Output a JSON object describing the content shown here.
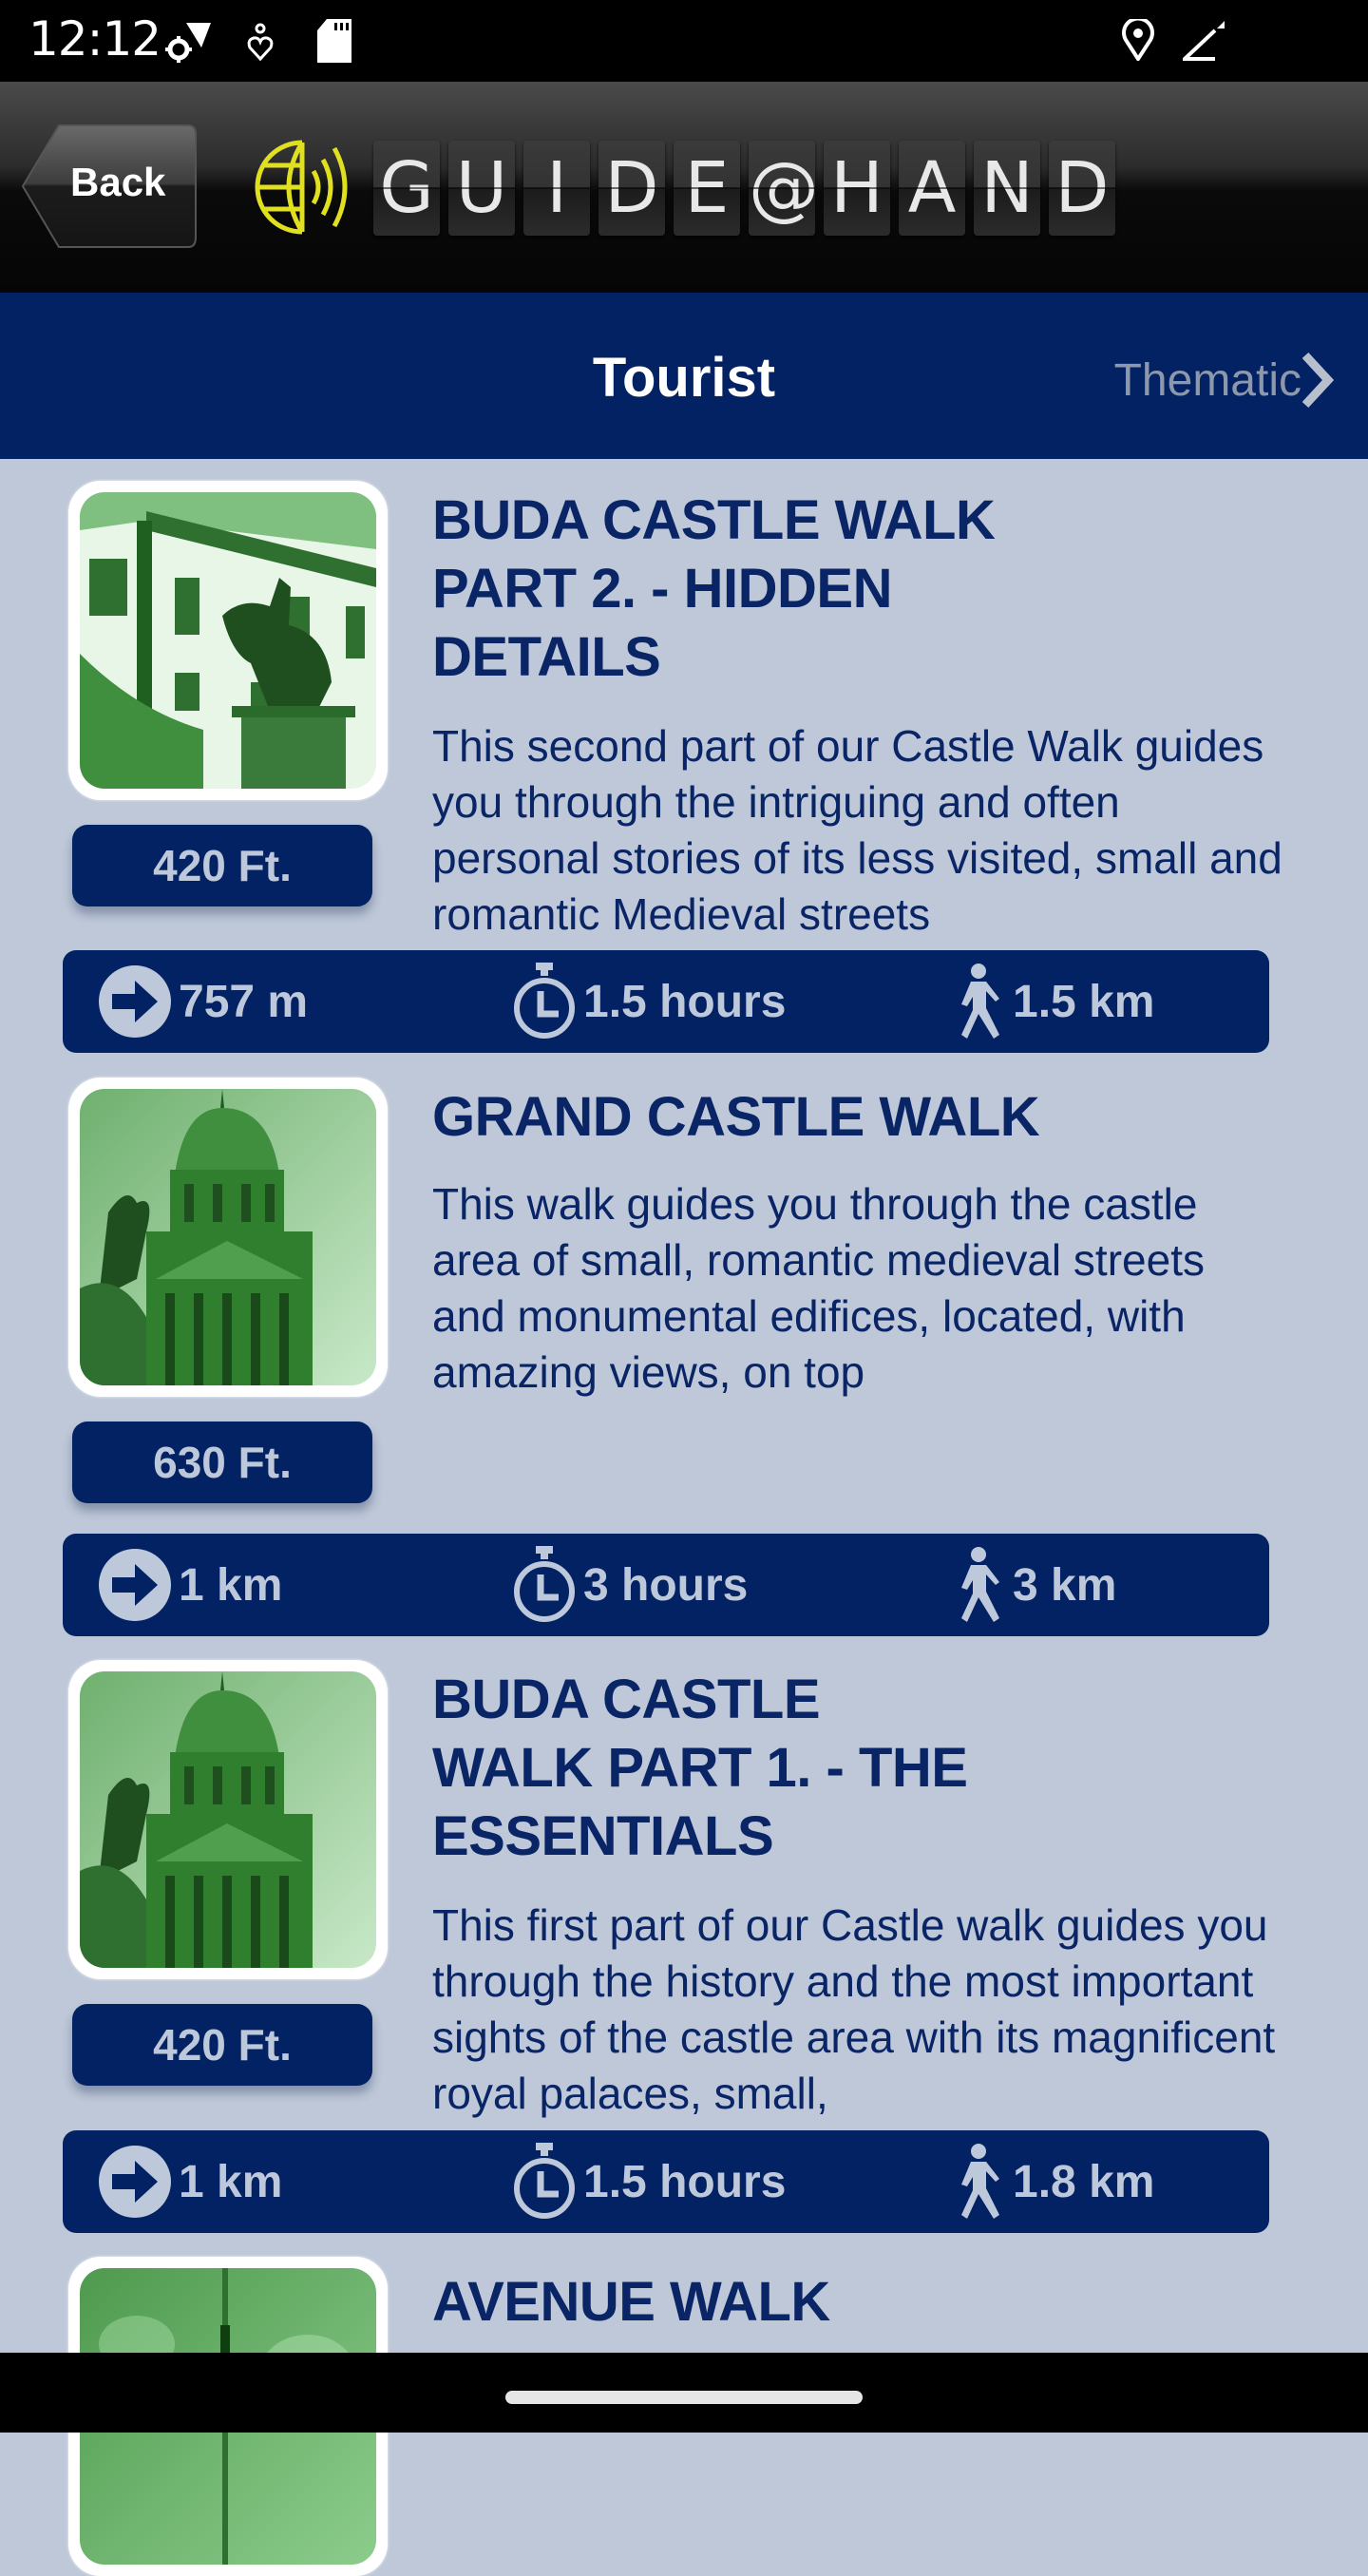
{
  "status_bar": {
    "time": "12:12",
    "left_icons": [
      "settings-wifi-icon",
      "download-icon",
      "sd-card-icon"
    ],
    "right_icons": [
      "location-icon",
      "signal-icon"
    ]
  },
  "header": {
    "back_label": "Back",
    "logo_letters": [
      "G",
      "U",
      "I",
      "D",
      "E",
      "@",
      "H",
      "A",
      "N",
      "D"
    ],
    "logo_text": "GUIDE@HAND",
    "logo_accent": "#e0e020"
  },
  "tabs": {
    "current": "Tourist",
    "next": "Thematic"
  },
  "colors": {
    "navy": "#022263",
    "background": "#bec8d8",
    "stat_text": "#bec8db",
    "title_text": "#0a2566"
  },
  "walks": [
    {
      "title": "BUDA CASTLE WALK PART 2. - HIDDEN DETAILS",
      "title_lines": [
        "BUDA CASTLE WALK",
        "PART 2. - HIDDEN",
        "DETAILS"
      ],
      "description": "This second part of our Castle Walk guides you through the intriguing and often personal stories of its less visited, small and romantic Medieval streets",
      "elevation": "420 Ft.",
      "distance_to_start": "757 m",
      "duration": "1.5 hours",
      "length": "1.5 km",
      "thumbnail": "equestrian-statue-building"
    },
    {
      "title": "GRAND CASTLE WALK",
      "title_lines": [
        "GRAND CASTLE WALK"
      ],
      "description": "This walk guides you through the castle area of small, romantic medieval streets and monumental edifices, located, with amazing views, on top",
      "elevation": "630 Ft.",
      "distance_to_start": "1 km",
      "duration": "3 hours",
      "length": "3 km",
      "thumbnail": "castle-dome"
    },
    {
      "title": "BUDA CASTLE WALK PART 1. - THE ESSENTIALS",
      "title_lines": [
        "BUDA CASTLE",
        "WALK PART 1. - THE",
        "ESSENTIALS"
      ],
      "description": "This first part of our Castle walk guides you through the history and the most important sights of the castle area with its magnificent royal palaces, small,",
      "elevation": "420 Ft.",
      "distance_to_start": "1 km",
      "duration": "1.5 hours",
      "length": "1.8 km",
      "thumbnail": "castle-dome"
    },
    {
      "title": "AVENUE WALK",
      "title_lines": [
        "AVENUE WALK"
      ],
      "thumbnail": "avenue"
    }
  ]
}
